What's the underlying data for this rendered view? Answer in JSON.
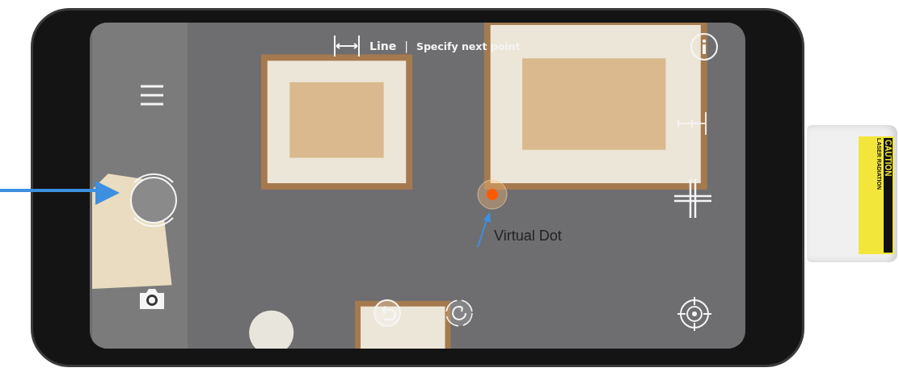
{
  "header": {
    "mode": "Line",
    "separator": "|",
    "instruction": "Specify next point"
  },
  "annotation": {
    "label": "Virtual Dot"
  },
  "device": {
    "label_title": "CAUTION",
    "label_text": "LASER RADIATION"
  }
}
